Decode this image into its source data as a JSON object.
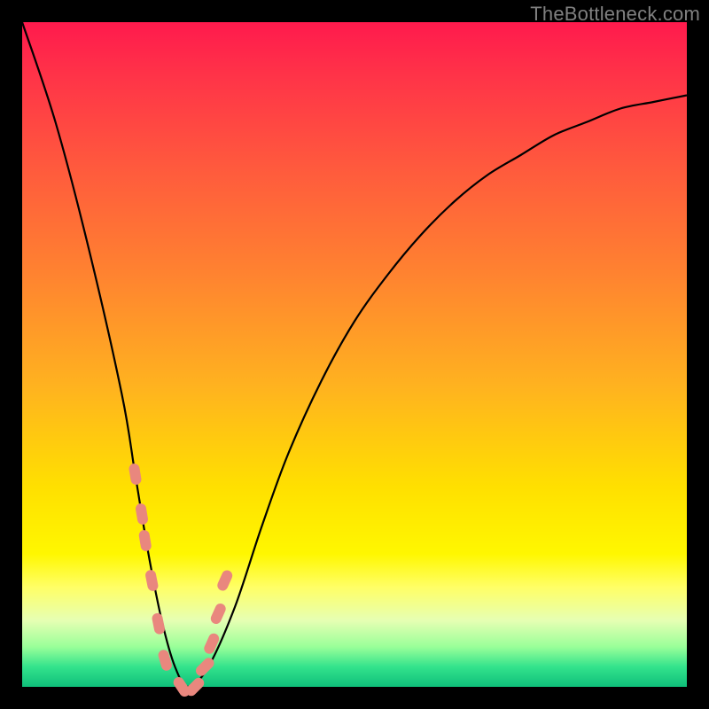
{
  "watermark": "TheBottleneck.com",
  "chart_data": {
    "type": "line",
    "title": "",
    "xlabel": "",
    "ylabel": "",
    "xlim": [
      0,
      1
    ],
    "ylim": [
      0,
      1
    ],
    "series": [
      {
        "name": "bottleneck-curve",
        "x": [
          0.0,
          0.05,
          0.1,
          0.15,
          0.17,
          0.19,
          0.21,
          0.23,
          0.25,
          0.28,
          0.32,
          0.36,
          0.4,
          0.45,
          0.5,
          0.55,
          0.6,
          0.65,
          0.7,
          0.75,
          0.8,
          0.85,
          0.9,
          0.95,
          1.0
        ],
        "y": [
          1.0,
          0.85,
          0.66,
          0.44,
          0.32,
          0.2,
          0.1,
          0.03,
          0.0,
          0.03,
          0.12,
          0.24,
          0.35,
          0.46,
          0.55,
          0.62,
          0.68,
          0.73,
          0.77,
          0.8,
          0.83,
          0.85,
          0.87,
          0.88,
          0.89
        ]
      }
    ],
    "markers": {
      "name": "highlight-dashes",
      "x": [
        0.17,
        0.18,
        0.185,
        0.195,
        0.205,
        0.215,
        0.24,
        0.26,
        0.275,
        0.285,
        0.295,
        0.305
      ],
      "y": [
        0.32,
        0.26,
        0.22,
        0.16,
        0.095,
        0.04,
        0.0,
        0.0,
        0.03,
        0.065,
        0.11,
        0.16
      ]
    },
    "colors": {
      "curve": "#000000",
      "marker": "#e9877e",
      "gradient_top": "#ff1a4d",
      "gradient_bottom": "#0fbf7a"
    }
  }
}
